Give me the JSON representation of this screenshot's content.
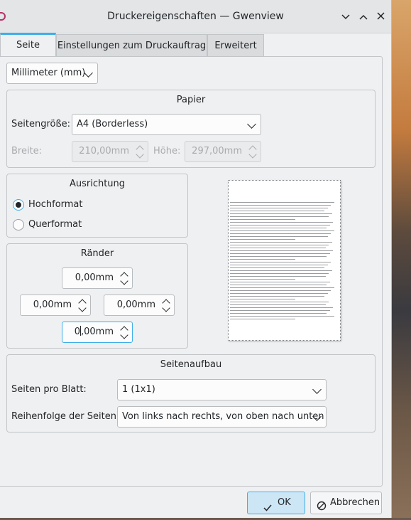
{
  "window": {
    "title": "Druckereigenschaften — Gwenview"
  },
  "tabs": [
    {
      "label": "Seite"
    },
    {
      "label": "Einstellungen zum Druckauftrag"
    },
    {
      "label": "Erweitert"
    }
  ],
  "units": {
    "value": "Millimeter (mm)"
  },
  "paper": {
    "title": "Papier",
    "size_label": "Seitengröße:",
    "size_value": "A4 (Borderless)",
    "width_label": "Breite:",
    "width_value": "210,00mm",
    "height_label": "Höhe:",
    "height_value": "297,00mm"
  },
  "orientation": {
    "title": "Ausrichtung",
    "portrait": "Hochformat",
    "landscape": "Querformat",
    "selected": "portrait"
  },
  "margins": {
    "title": "Ränder",
    "top": "0,00mm",
    "left": "0,00mm",
    "right": "0,00mm",
    "bottom_before_cursor": "0",
    "bottom_after_cursor": ",00mm"
  },
  "layout": {
    "title": "Seitenaufbau",
    "pages_label": "Seiten pro Blatt:",
    "pages_value": "1 (1x1)",
    "order_label": "Reihenfolge der Seiten:",
    "order_value": "Von links nach rechts, von oben nach unten"
  },
  "buttons": {
    "ok": "OK",
    "cancel": "Abbrechen"
  },
  "icons": [
    "app-icon",
    "minimize-icon",
    "maximize-icon",
    "close-icon",
    "check-icon",
    "cancel-icon"
  ]
}
